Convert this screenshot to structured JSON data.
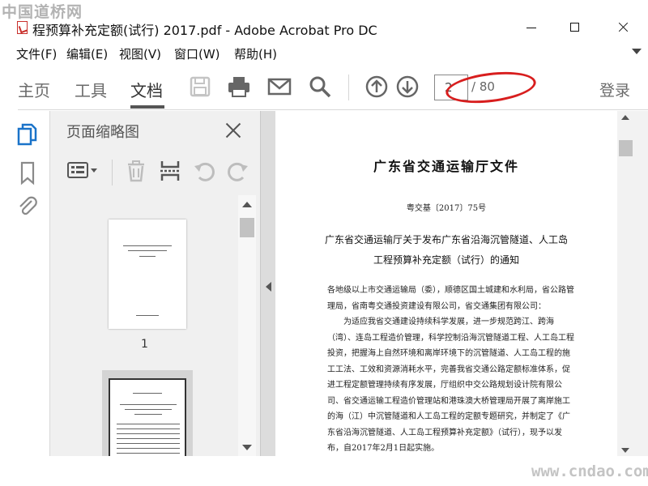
{
  "watermark_top": "中国道桥网",
  "watermark_bottom": "www.cndao.com",
  "window": {
    "title": "程预算补充定额(试行) 2017.pdf - Adobe Acrobat Pro DC"
  },
  "menu": [
    "文件(F)",
    "编辑(E)",
    "视图(V)",
    "窗口(W)",
    "帮助(H)"
  ],
  "toolbar": {
    "tabs": [
      "主页",
      "工具",
      "文档"
    ],
    "active_tab": "文档",
    "icons": [
      "save-icon",
      "print-icon",
      "email-icon",
      "search-icon",
      "arrow-up-circle-icon",
      "arrow-down-circle-icon"
    ],
    "page_current": "2",
    "page_total": "/ 80",
    "login": "登录"
  },
  "left_rail": {
    "icons": [
      "pages-icon",
      "bookmark-icon",
      "attachment-icon"
    ]
  },
  "thumbnail_panel": {
    "title": "页面缩略图",
    "tool_icons": [
      "options-icon",
      "delete-icon",
      "insert-page-icon",
      "rotate-ccw-icon",
      "rotate-cw-icon"
    ],
    "thumbnails": [
      {
        "page_label": "1"
      }
    ]
  },
  "document": {
    "title": "广东省交通运输厅文件",
    "reference": "粤交基〔2017〕75号",
    "subtitle_line1": "广东省交通运输厅关于发布广东省沿海沉管隧道、人工岛",
    "subtitle_line2": "工程预算补充定额（试行）的通知",
    "paragraphs": [
      "各地级以上市交通运输局（委），顺德区国土城建和水利局，省公路管理局，省南粤交通投资建设有限公司，省交通集团有限公司：",
      "为适应我省交通建设持续科学发展，进一步规范跨江、跨海（湾）、连岛工程造价管理，科学控制沿海沉管隧道工程、人工岛工程投资，把握海上自然环境和离岸环境下的沉管隧道、人工岛工程的施工工法、工效和资源消耗水平，完善我省交通公路定额标准体系，促进工程定额管理持续有序发展，厅组织中交公路规划设计院有限公司、省交通运输工程造价管理站和港珠澳大桥管理局开展了离岸施工的海（江）中沉管隧道和人工岛工程的定额专题研究，并制定了《广东省沿海沉管隧道、人工岛工程预算补充定额》（试行），现予以发布，自2017年2月1日起实施。"
    ]
  },
  "colors": {
    "accent_blue": "#1a73c9",
    "annotation_red": "#d81e1e"
  }
}
